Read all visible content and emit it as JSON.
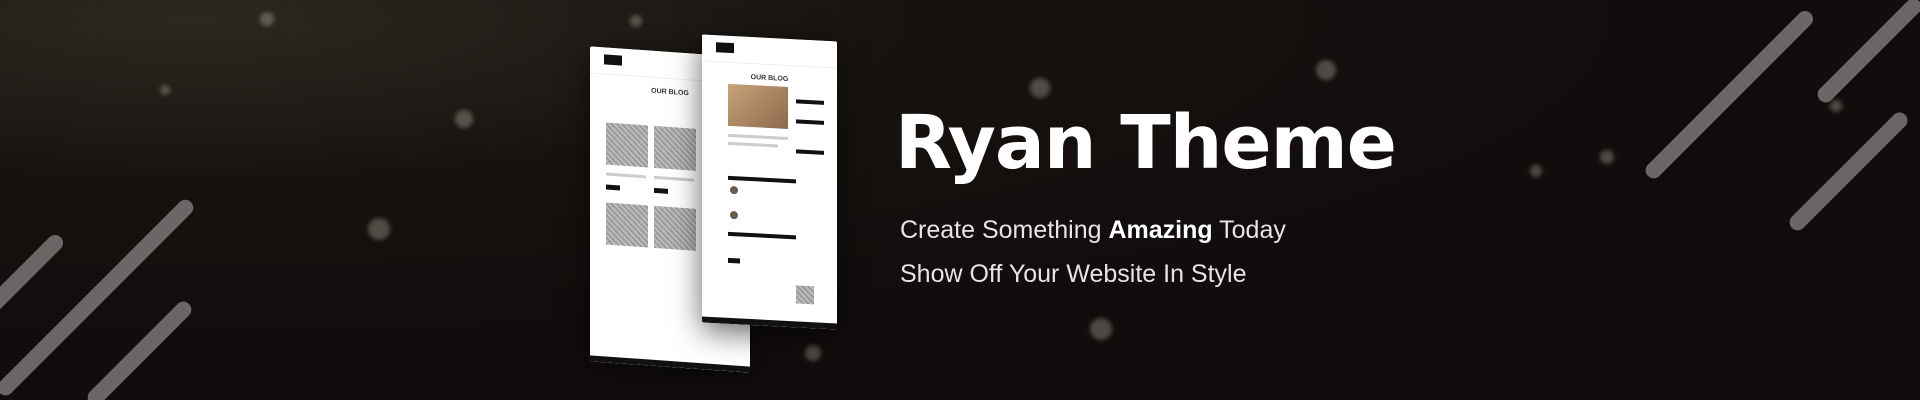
{
  "headline": "Ryan Theme",
  "tagline_1": {
    "before": "Create Something ",
    "bold": "Amazing",
    "after": " Today"
  },
  "tagline_2": "Show Off Your Website In Style",
  "mockup": {
    "page_title": "OUR BLOG"
  },
  "colors": {
    "background": "#140f0f",
    "stripe": "#6b6767",
    "text": "#ffffff"
  }
}
